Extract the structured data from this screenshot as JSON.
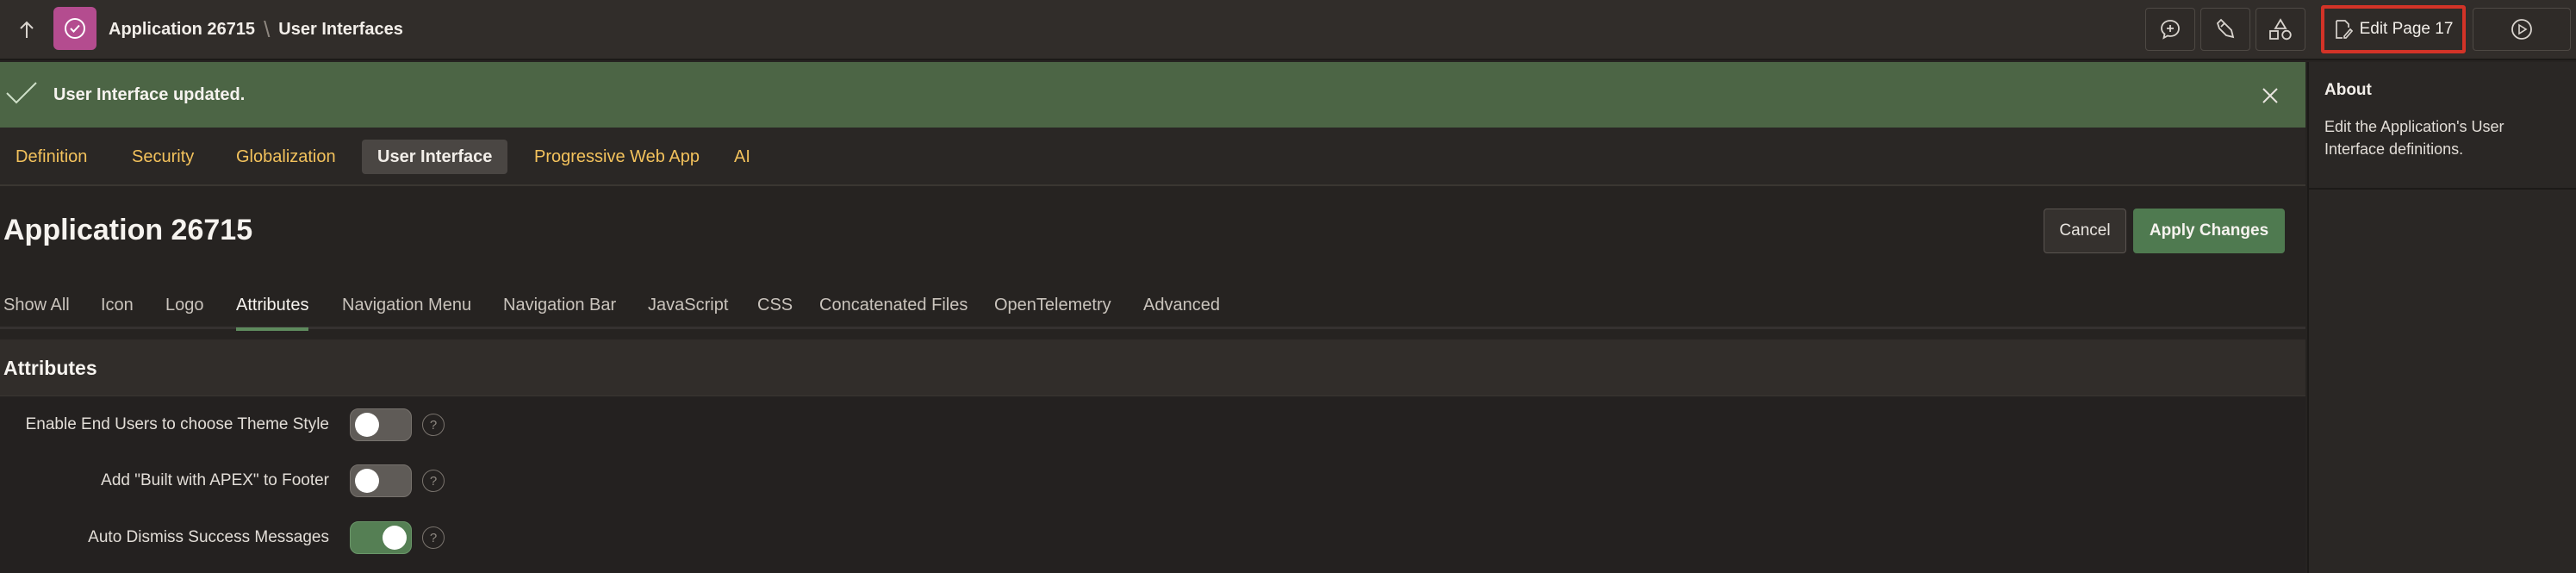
{
  "header": {
    "app_name": "Application 26715",
    "separator": "\\",
    "current_page": "User Interfaces",
    "edit_page_label": "Edit Page 17"
  },
  "notification": {
    "message": "User Interface updated."
  },
  "main_tabs": [
    {
      "label": "Definition"
    },
    {
      "label": "Security"
    },
    {
      "label": "Globalization"
    },
    {
      "label": "User Interface",
      "active": true
    },
    {
      "label": "Progressive Web App"
    },
    {
      "label": "AI"
    }
  ],
  "page": {
    "title": "Application 26715",
    "cancel_label": "Cancel",
    "apply_label": "Apply Changes"
  },
  "sub_tabs": [
    {
      "label": "Show All"
    },
    {
      "label": "Icon"
    },
    {
      "label": "Logo"
    },
    {
      "label": "Attributes",
      "active": true
    },
    {
      "label": "Navigation Menu"
    },
    {
      "label": "Navigation Bar"
    },
    {
      "label": "JavaScript"
    },
    {
      "label": "CSS"
    },
    {
      "label": "Concatenated Files"
    },
    {
      "label": "OpenTelemetry"
    },
    {
      "label": "Advanced"
    }
  ],
  "attributes": {
    "heading": "Attributes",
    "rows": [
      {
        "label": "Enable End Users to choose Theme Style",
        "value": false
      },
      {
        "label": "Add \"Built with APEX\" to Footer",
        "value": false
      },
      {
        "label": "Auto Dismiss Success Messages",
        "value": true
      }
    ],
    "help_glyph": "?"
  },
  "side_panel": {
    "title": "About",
    "text": "Edit the Application's User Interface definitions."
  },
  "icons": {
    "up": "arrow-up-icon",
    "app": "check-circle-icon",
    "comment": "comment-add-icon",
    "developer": "wrench-icon",
    "shared": "shapes-icon",
    "edit": "edit-page-icon",
    "run": "play-circle-icon",
    "success": "checkmark-icon",
    "close": "close-icon"
  },
  "colors": {
    "accent_tab": "#f3c25c",
    "success_bg": "#4c6545",
    "apply_button": "#4f7a50",
    "highlight_border": "#d33327",
    "app_badge": "#b44c8f"
  }
}
